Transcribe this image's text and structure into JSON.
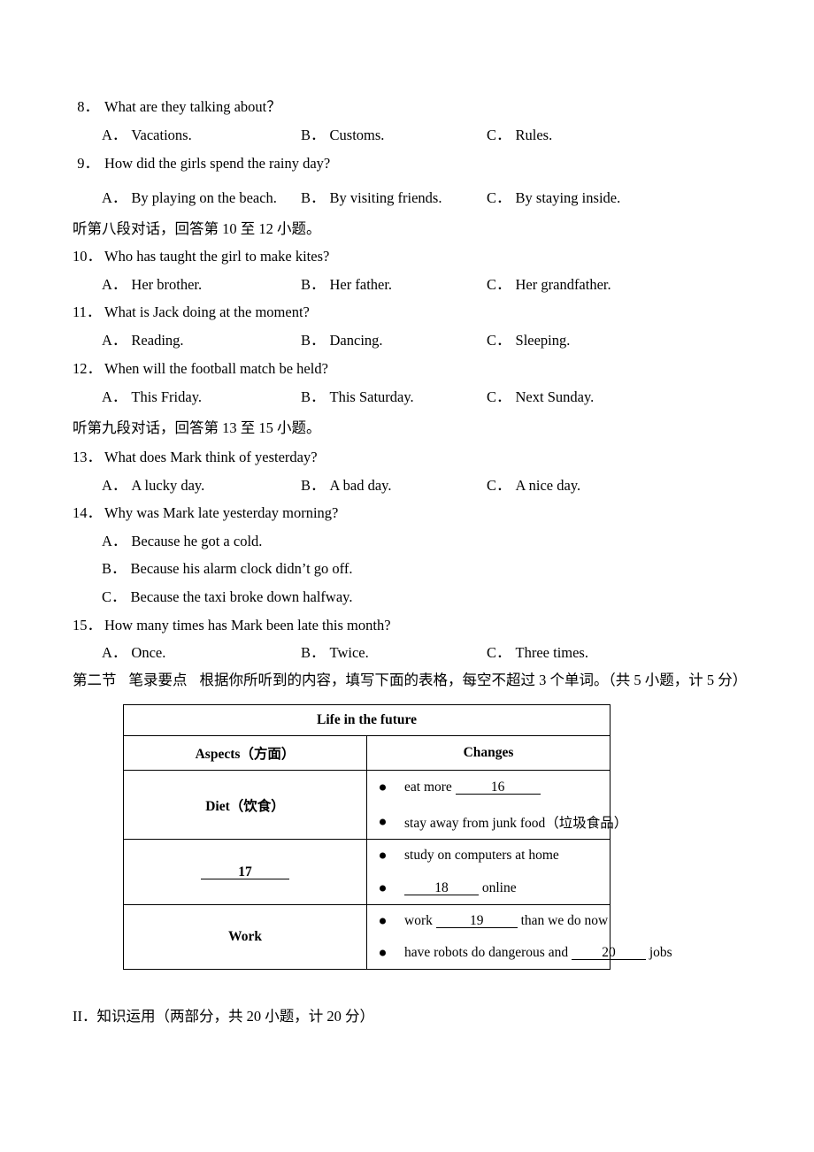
{
  "document": {
    "type": "english-exam-paper",
    "page_background": "#ffffff",
    "text_color": "#000000"
  },
  "questions": [
    {
      "number": "8．",
      "stem": "What are they talking about？",
      "layout": "inline",
      "options": [
        {
          "label": "A．",
          "text": "Vacations."
        },
        {
          "label": "B．",
          "text": "Customs."
        },
        {
          "label": "C．",
          "text": "Rules."
        }
      ]
    },
    {
      "number": "9．",
      "stem": "How did the girls spend the rainy day?",
      "layout": "inline",
      "options": [
        {
          "label": "A．",
          "text": "By playing on the beach."
        },
        {
          "label": "B．",
          "text": "By visiting friends."
        },
        {
          "label": "C．",
          "text": "By staying inside."
        }
      ]
    },
    {
      "number": "10．",
      "stem": "Who has taught the girl to make kites?",
      "layout": "inline",
      "options": [
        {
          "label": "A．",
          "text": "Her brother."
        },
        {
          "label": "B．",
          "text": "Her father."
        },
        {
          "label": "C．",
          "text": "Her grandfather."
        }
      ]
    },
    {
      "number": "11．",
      "stem": "What is Jack doing at the moment?",
      "layout": "inline",
      "options": [
        {
          "label": "A．",
          "text": "Reading."
        },
        {
          "label": "B．",
          "text": "Dancing."
        },
        {
          "label": "C．",
          "text": "Sleeping."
        }
      ]
    },
    {
      "number": "12．",
      "stem": "When will the football match be held?",
      "layout": "inline",
      "options": [
        {
          "label": "A．",
          "text": "This Friday."
        },
        {
          "label": "B．",
          "text": "This Saturday."
        },
        {
          "label": "C．",
          "text": "Next Sunday."
        }
      ]
    },
    {
      "number": "13．",
      "stem": "What does Mark think of yesterday?",
      "layout": "inline",
      "options": [
        {
          "label": "A．",
          "text": "A lucky day."
        },
        {
          "label": "B．",
          "text": "A bad day."
        },
        {
          "label": "C．",
          "text": "A nice day."
        }
      ]
    },
    {
      "number": "14．",
      "stem": "Why was Mark late yesterday morning?",
      "layout": "stacked",
      "options": [
        {
          "label": "A．",
          "text": "Because he got a cold."
        },
        {
          "label": "B．",
          "text": "Because his alarm clock didn’t go off."
        },
        {
          "label": "C．",
          "text": "Because the taxi broke down halfway."
        }
      ]
    },
    {
      "number": "15．",
      "stem": "How many times has Mark been late this month?",
      "layout": "inline",
      "options": [
        {
          "label": "A．",
          "text": "Once."
        },
        {
          "label": "B．",
          "text": "Twice."
        },
        {
          "label": "C．",
          "text": "Three times."
        }
      ]
    }
  ],
  "directions": {
    "dialogue_eight": "听第八段对话，回答第 10 至 12 小题。",
    "dialogue_nine": "听第九段对话，回答第 13 至 15 小题。",
    "part_two_label": "第二节",
    "part_two_name": "笔录要点",
    "part_two_text": "根据你所听到的内容，填写下面的表格，每空不超过 3 个单词。（共 5 小题，计 5 分）",
    "section_two": "II．知识运用（两部分，共 20 小题，计 20 分）"
  },
  "note_table": {
    "title": "Life in the future",
    "headers": {
      "aspects": "Aspects（方面）",
      "changes": "Changes"
    },
    "rows": [
      {
        "aspect": "Diet（饮食）",
        "aspect_is_blank": false,
        "items": [
          {
            "before": "eat more",
            "blank": "16",
            "after": ""
          },
          {
            "before": "stay away from junk food（垃圾食品）",
            "blank": "",
            "after": ""
          }
        ]
      },
      {
        "aspect": "17",
        "aspect_is_blank": true,
        "items": [
          {
            "before": "study on computers at home",
            "blank": "",
            "after": ""
          },
          {
            "before": "",
            "blank": "18",
            "after": "online"
          }
        ]
      },
      {
        "aspect": "Work",
        "aspect_is_blank": false,
        "items": [
          {
            "before": "work",
            "blank": "19",
            "after": "than we do now"
          },
          {
            "before": "have robots do dangerous and",
            "blank": "20",
            "after": "jobs"
          }
        ]
      }
    ]
  }
}
